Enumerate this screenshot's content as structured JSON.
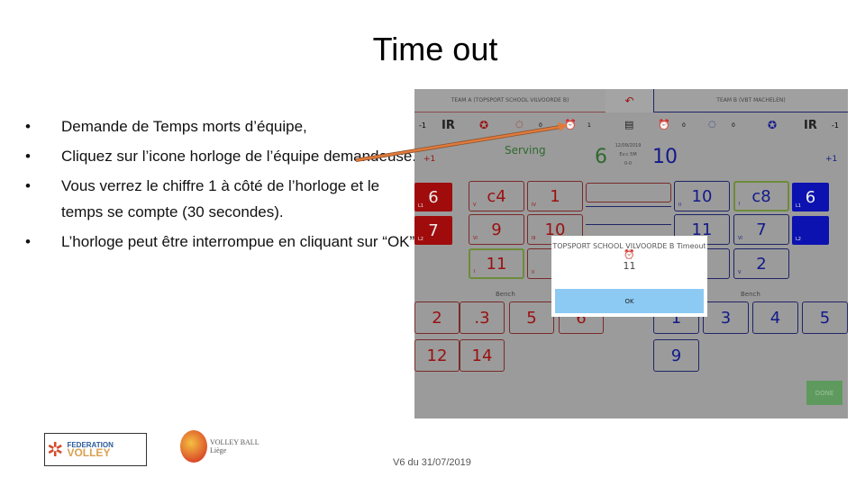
{
  "slide": {
    "title": "Time out",
    "bullets": [
      "Demande de Temps morts d’équipe,",
      "Cliquez sur l’icone horloge de l’équipe demandeuse.",
      "Vous verrez le chiffre 1 à côté de l’horloge et le temps se compte (30 secondes).",
      "L’horloge peut être interrompue en cliquant sur “OK”."
    ],
    "footer": "V6 du 31/07/2019",
    "logos": [
      "FEDERATION VOLLEY WALLONIE BRUXELLES",
      "VOLLEY BALL Liège"
    ],
    "arrow_color": "#e07a3a"
  },
  "app": {
    "team_a_tab": "TEAM A (TOPSPORT SCHOOL VILVOORDE B)",
    "team_b_tab": "TEAM B (VBT MACHELEN)",
    "team_a": {
      "minus": "-1",
      "ir": "IR",
      "subs": "0",
      "timeouts": "1",
      "plus": "+1",
      "serving": "Serving",
      "score": "6",
      "color": "#9b1010",
      "liberos": [
        {
          "pos": "L1",
          "num": "6"
        },
        {
          "pos": "L2",
          "num": "7"
        }
      ],
      "court": [
        {
          "pos": "V",
          "num": "c4"
        },
        {
          "pos": "IV",
          "num": "1"
        },
        {
          "pos": "VI",
          "num": "9"
        },
        {
          "pos": "III",
          "num": "10"
        },
        {
          "pos": "I",
          "num": "11"
        },
        {
          "pos": "II",
          "num": "1"
        }
      ],
      "bench": [
        "2",
        ".3",
        "5",
        "6",
        "12",
        "14"
      ]
    },
    "team_b": {
      "minus": "-1",
      "ir": "IR",
      "subs": "0",
      "timeouts": "0",
      "plus": "+1",
      "score": "10",
      "color": "#121a8a",
      "liberos": [
        {
          "pos": "L1",
          "num": "6"
        },
        {
          "pos": "L2",
          "num": ""
        }
      ],
      "court": [
        {
          "pos": "II",
          "num": "10"
        },
        {
          "pos": "I",
          "num": "c8"
        },
        {
          "pos": "III",
          "num": "11"
        },
        {
          "pos": "VI",
          "num": "7"
        },
        {
          "pos": "IV",
          "num": "2"
        },
        {
          "pos": "V",
          "num": "2"
        }
      ],
      "bench": [
        "1",
        "3",
        "4",
        "5",
        "9"
      ]
    },
    "middle_info": [
      "12/09/2019",
      "Ev:c 5M",
      "0-0"
    ],
    "bench_label": "Bench",
    "dialog": {
      "title": "TOPSPORT SCHOOL VILVOORDE B Timeout",
      "count": "11",
      "ok": "OK"
    },
    "done": "DONE"
  }
}
